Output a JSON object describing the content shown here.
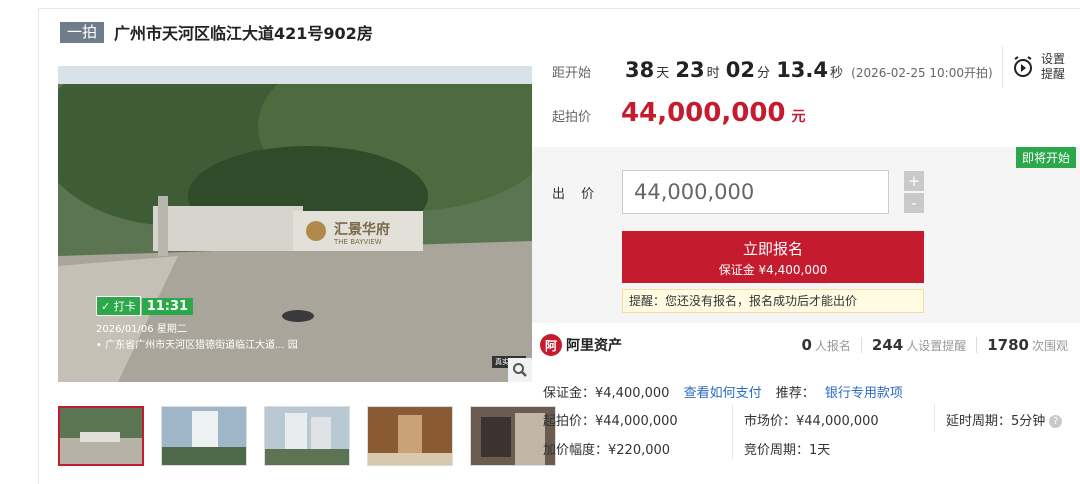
{
  "header": {
    "round_tag": "一拍",
    "title": "广州市天河区临江大道421号902房"
  },
  "countdown": {
    "label": "距开始",
    "days": "38",
    "days_unit": "天",
    "hours": "23",
    "hours_unit": "时",
    "minutes": "02",
    "minutes_unit": "分",
    "seconds": "13.4",
    "seconds_unit": "秒",
    "start_note": "(2026-02-25 10:00开拍)"
  },
  "reminder": {
    "line1": "设置",
    "line2": "提醒"
  },
  "starting_price": {
    "label": "起拍价",
    "value": "44,000,000",
    "unit": "元"
  },
  "bid": {
    "badge": "即将开始",
    "label": "出 价",
    "input_value": "44,000,000",
    "plus": "+",
    "minus": "-",
    "register_label": "立即报名",
    "deposit_note": "保证金 ¥4,400,000",
    "tip": "提醒：您还没有报名，报名成功后才能出价"
  },
  "platform": {
    "logo_mark": "阿",
    "name": "阿里资产",
    "registrations": "0",
    "registrations_label": "人报名",
    "reminders": "244",
    "reminders_label": "人设置提醒",
    "views": "1780",
    "views_label": "次围观"
  },
  "details": {
    "deposit": "保证金：¥4,400,000",
    "how_to_pay": "查看如何支付",
    "recommend": "推荐：",
    "bank_link": "银行专用款项",
    "start_price": "起拍价：¥44,000,000",
    "market_price": "市场价：¥44,000,000",
    "extension": "延时周期：5分钟",
    "increment": "加价幅度：¥220,000",
    "cycle": "竞价周期：1天"
  },
  "photo": {
    "checkin_label": "✓ 打卡",
    "checkin_time": "11:31",
    "date_line": "2026/01/06  星期二",
    "address_line": "• 广东省广州市天河区猎德街道临江大道... 园",
    "sign_cn": "汇景华府",
    "sign_en": "THE BAYVIEW",
    "watermark": "真实时间",
    "zoom_icon": "search-icon"
  },
  "colors": {
    "accent": "#c51b2e",
    "link": "#2b6cc4",
    "badge": "#2aa84a",
    "tag": "#6f7c8a"
  }
}
